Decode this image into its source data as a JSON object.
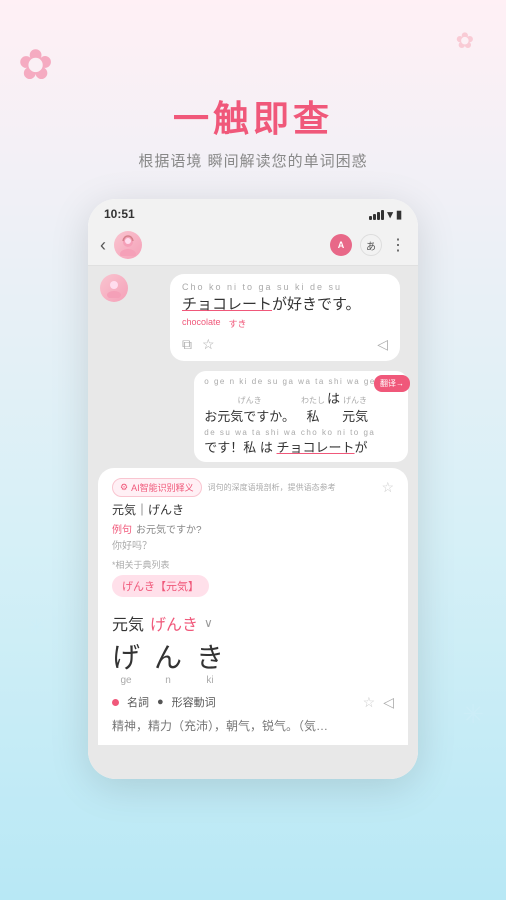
{
  "decorations": {
    "flower_symbol": "✿",
    "asterisk_symbol": "✳"
  },
  "top_text": {
    "title": "一触即查",
    "subtitle": "根据语境  瞬间解读您的单词困惑"
  },
  "status_bar": {
    "time": "10:51",
    "signal": "▼▲",
    "battery": "▮"
  },
  "chat_header": {
    "back_icon": "‹",
    "a_label": "A",
    "ja_label": "あ",
    "more_icon": "⋮"
  },
  "message1": {
    "romaji": "Cho  ko  ni  to  ga  su  ki  de  su",
    "japanese": "チョコレートが好きです。",
    "underline_word": "チョコレート",
    "annotation1": "chocolate",
    "annotation2": "すき",
    "copy_icon": "⧉",
    "star_icon": "☆",
    "sound_icon": "◁"
  },
  "message2": {
    "line1_romaji": "o  ge n ki  de su  ga",
    "line1_jp1": "お元気ですか。",
    "line1_furigana1": "げんき",
    "line1_jp2": "私",
    "line1_furigana2": "わたし",
    "line1_jp3": "は 元気",
    "line1_furigana3": "げんき",
    "line2_romaji": "de su  wa ta shi  wa  cho ko  ni  to  ga",
    "line2_jp": "です！私 は チョコレートが",
    "translate_label": "翻译→"
  },
  "dict_panel": {
    "ai_icon": "⚙",
    "ai_label": "AI智能识别释义",
    "smart_label": "词句的深度语境剖析，提供语态参考",
    "word": "元気｜げんき",
    "example_label": "例句",
    "example_jp": "お元気ですか?",
    "translation": "你好吗？",
    "related_label": "*相关于典列表",
    "related_tag": "げんき【元気】",
    "word_kanji": "元気",
    "word_kana": "げんき",
    "kana1_char": "げ",
    "kana1_rom": "ge",
    "kana2_char": "ん",
    "kana2_rom": "n",
    "kana3_char": "き",
    "kana3_rom": "ki",
    "pos1": "名詞",
    "pos_sep": "●",
    "pos2": "形容動词",
    "meaning": "精神，精力（充沛），朝气，锐气。（気…",
    "star_icon": "☆",
    "sound_icon": "◁"
  }
}
